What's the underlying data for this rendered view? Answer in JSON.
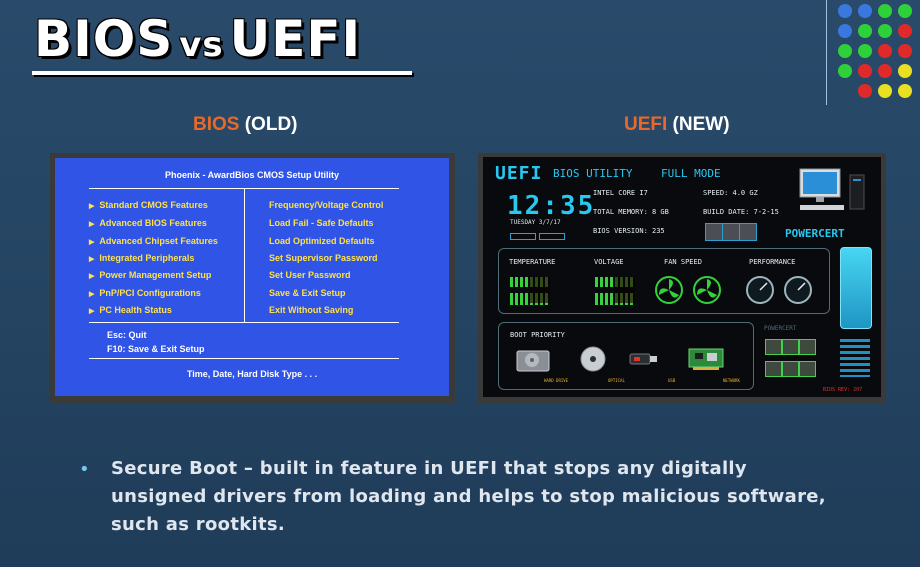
{
  "slide": {
    "title_left": "BIOS",
    "title_vs": "vs",
    "title_right": "UEFI",
    "bios_caption_accent": "BIOS",
    "bios_caption_rest": " (OLD)",
    "uefi_caption_accent": "UEFI",
    "uefi_caption_rest": " (NEW)",
    "bullet_text": "Secure Boot – built in feature in UEFI that stops any digitally unsigned drivers from loading and helps to stop malicious software, such as rootkits.",
    "colors": {
      "accent": "#e8692a",
      "bios_blue": "#2f54e6",
      "bios_yellow": "#ffe24a",
      "uefi_cyan": "#29c8f0"
    }
  },
  "bios": {
    "title": "Phoenix  -  AwardBios CMOS Setup Utility",
    "left_items": [
      "Standard CMOS Features",
      "Advanced BIOS Features",
      "Advanced Chipset Features",
      "Integrated Peripherals",
      "Power Management Setup",
      "PnP/PCI Configurations",
      "PC Health Status"
    ],
    "right_items": [
      "Frequency/Voltage Control",
      "Load Fail - Safe Defaults",
      "Load Optimized Defaults",
      "Set Supervisor Password",
      "Set User Password",
      "Save & Exit Setup",
      "Exit Without Saving"
    ],
    "esc_label": "Esc:  Quit",
    "f10_label": "F10:  Save & Exit Setup",
    "footer": "Time, Date, Hard Disk Type . . ."
  },
  "uefi": {
    "logo": "UEFI",
    "utility": "BIOS UTILITY",
    "mode": "FULL MODE",
    "time": "12:35",
    "date": "TUESDAY 3/7/17",
    "cpu": "INTEL CORE I7",
    "memory": "TOTAL MEMORY:  8 GB",
    "bios_version": "BIOS VERSION:  235",
    "speed": "SPEED:  4.0 GZ",
    "build_date": "BUILD DATE: 7-2-15",
    "brand": "POWERCERT",
    "brand_small": "POWERCERT",
    "temp_label": "TEMPERATURE",
    "voltage_label": "VOLTAGE",
    "fan_label": "FAN SPEED",
    "perf_label": "PERFORMANCE",
    "boot_label": "BOOT PRIORITY",
    "boot_devices": [
      "HARD DRIVE",
      "OPTICAL",
      "USB",
      "NETWORK"
    ],
    "bios_rev": "BIOS REV: 207"
  }
}
